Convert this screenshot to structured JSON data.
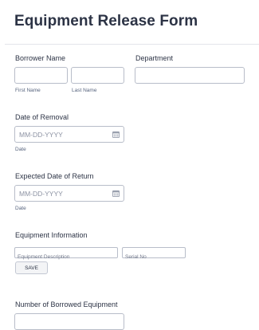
{
  "form": {
    "title": "Equipment Release Form",
    "borrower": {
      "label": "Borrower Name",
      "first_value": "",
      "last_value": "",
      "first_sublabel": "First Name",
      "last_sublabel": "Last Name"
    },
    "department": {
      "label": "Department",
      "value": ""
    },
    "removal_date": {
      "label": "Date of Removal",
      "placeholder": "MM-DD-YYYY",
      "sublabel": "Date",
      "icon": "calendar-icon"
    },
    "return_date": {
      "label": "Expected Date of Return",
      "placeholder": "MM-DD-YYYY",
      "sublabel": "Date",
      "icon": "calendar-icon"
    },
    "equipment": {
      "label": "Equipment Information",
      "description_placeholder": "Equipment Description",
      "serial_placeholder": "Serial No",
      "save_label": "SAVE"
    },
    "borrowed_count": {
      "label": "Number of Borrowed Equipment",
      "value": ""
    }
  }
}
